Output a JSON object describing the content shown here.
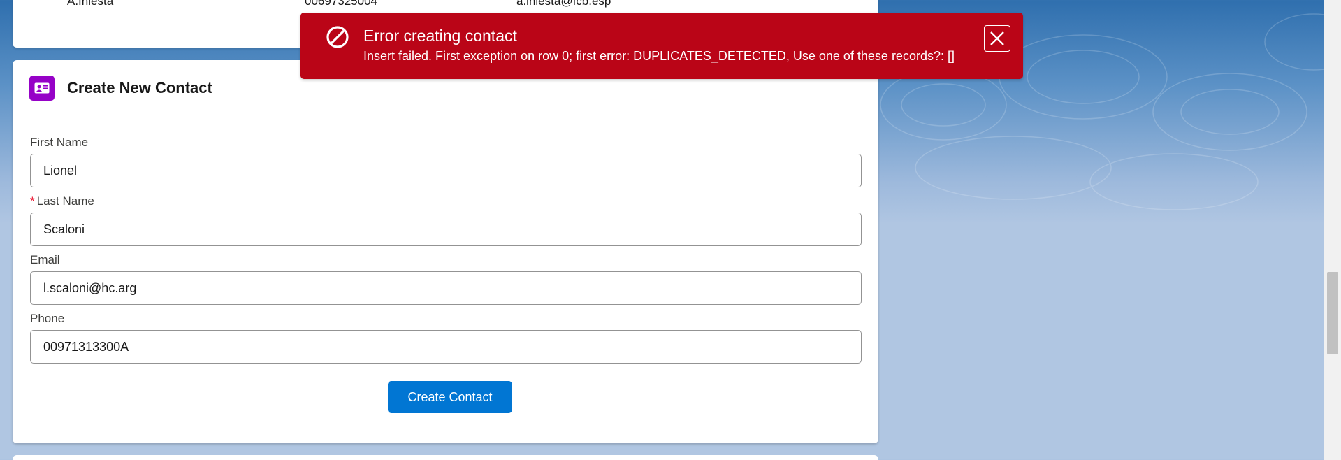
{
  "previous_row": {
    "name": "A.Iniesta",
    "phone": "00697325004",
    "email": "a.iniesta@fcb.esp"
  },
  "form": {
    "title": "Create New Contact",
    "icon": "contact-card-icon",
    "first_name": {
      "label": "First Name",
      "value": "Lionel"
    },
    "last_name": {
      "required_mark": "*",
      "label": "Last Name",
      "value": "Scaloni"
    },
    "email": {
      "label": "Email",
      "value": "l.scaloni@hc.arg"
    },
    "phone": {
      "label": "Phone",
      "value": "00971313300A"
    },
    "submit_label": "Create Contact"
  },
  "toast": {
    "variant": "error",
    "title": "Error creating contact",
    "message": "Insert failed. First exception on row 0; first error: DUPLICATES_DETECTED, Use one of these records?: []",
    "icon": "ban-icon",
    "close_icon": "close-icon"
  },
  "colors": {
    "brand": "#0176d3",
    "error": "#ba0517",
    "header_icon_bg": "#9602c7"
  }
}
